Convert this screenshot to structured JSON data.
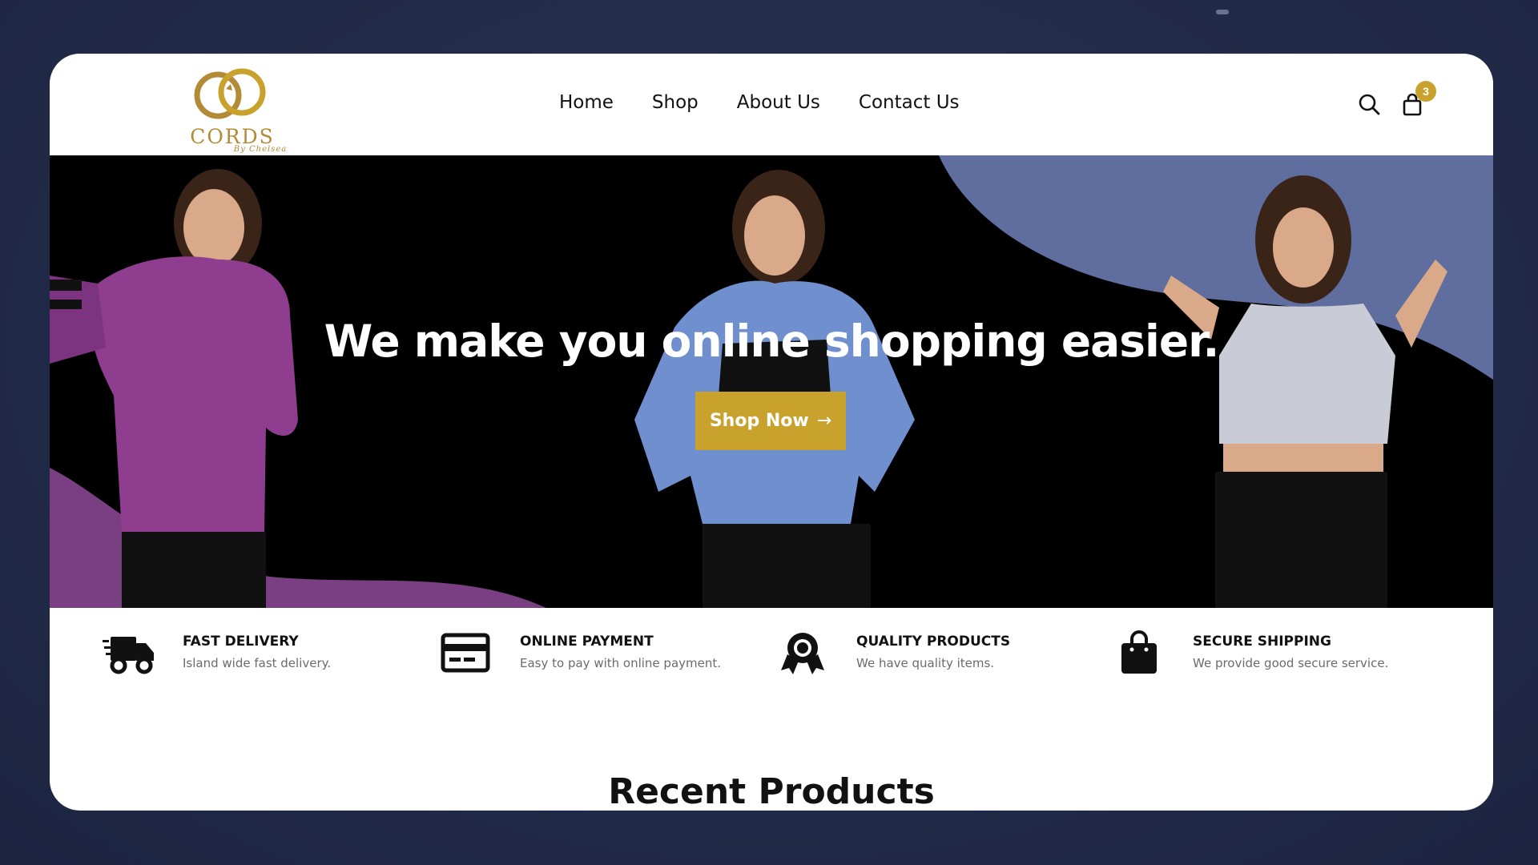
{
  "brand": {
    "name": "CORDS",
    "tagline": "By Chelsea",
    "accent": "#c9a22e"
  },
  "nav": {
    "items": [
      "Home",
      "Shop",
      "About Us",
      "Contact Us"
    ]
  },
  "header": {
    "search_icon": "search-icon",
    "cart_icon": "shopping-bag-icon",
    "cart_count": "3"
  },
  "hero": {
    "headline": "We make you online shopping easier.",
    "cta_label": "Shop Now",
    "cta_icon": "arrow-right-icon",
    "colors": {
      "background": "#000000",
      "blob_blue": "#5f6e9e",
      "blob_purple": "#7a3f82"
    }
  },
  "features": [
    {
      "icon": "delivery-truck-icon",
      "title": "FAST DELIVERY",
      "subtitle": "Island wide fast delivery."
    },
    {
      "icon": "credit-card-icon",
      "title": "ONLINE PAYMENT",
      "subtitle": "Easy to pay with online payment."
    },
    {
      "icon": "award-ribbon-icon",
      "title": "QUALITY PRODUCTS",
      "subtitle": "We have quality items."
    },
    {
      "icon": "shopping-bag-icon",
      "title": "SECURE SHIPPING",
      "subtitle": "We provide good secure service."
    }
  ],
  "sections": {
    "recent_products_title": "Recent Products"
  }
}
